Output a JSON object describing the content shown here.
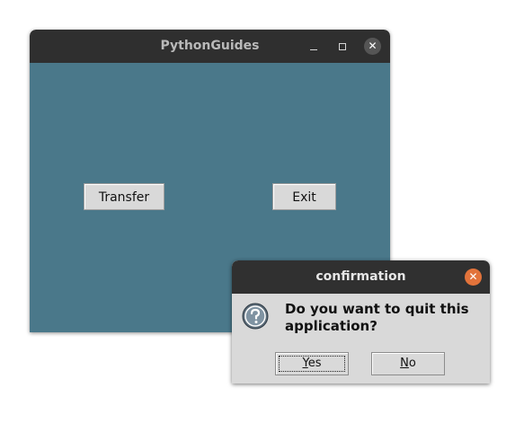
{
  "main_window": {
    "title": "PythonGuides",
    "buttons": {
      "transfer_label": "Transfer",
      "exit_label": "Exit"
    },
    "colors": {
      "background": "#4a788a",
      "titlebar": "#2f2f2f"
    }
  },
  "dialog": {
    "title": "confirmation",
    "message": "Do you want to quit this application?",
    "icon": "question-icon",
    "yes": {
      "mnemonic": "Y",
      "rest": "es"
    },
    "no": {
      "mnemonic": "N",
      "rest": "o"
    },
    "colors": {
      "close_button": "#e2733b",
      "body": "#d9d9d9"
    }
  }
}
